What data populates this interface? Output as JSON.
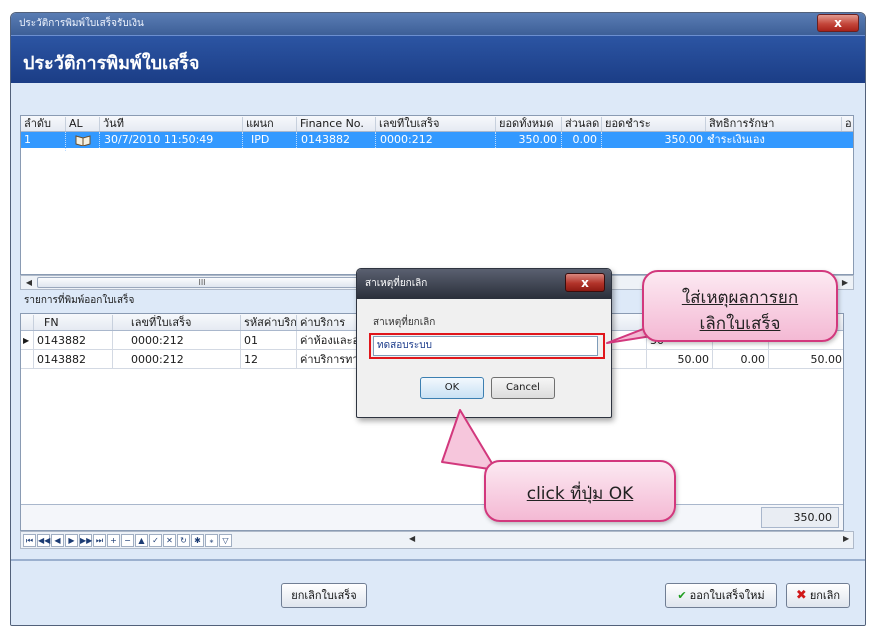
{
  "window": {
    "title": "ประวัติการพิมพ์ใบเสร็จรับเงิน",
    "close_glyph": "x"
  },
  "header": {
    "title": "ประวัติการพิมพ์ใบเสร็จ"
  },
  "receipts_grid": {
    "columns": [
      "ลำดับ",
      "AL",
      "วันที่",
      "แผนก",
      "Finance No.",
      "เลขที่ใบเสร็จ",
      "ยอดทั้งหมด",
      "ส่วนลด",
      "ยอดชำระ",
      "สิทธิการรักษา",
      "อ"
    ],
    "rows": [
      {
        "seq": "1",
        "al_icon": "book-icon",
        "date": "30/7/2010 11:50:49",
        "dept": "IPD",
        "finance_no": "0143882",
        "receipt_no": "0000:212",
        "total": "350.00",
        "discount": "0.00",
        "paid": "350.00",
        "right": "ชำระเงินเอง"
      }
    ],
    "scroll_glyph": "III"
  },
  "items_section": {
    "label": "รายการที่พิมพ์ออกใบเสร็จ"
  },
  "items_grid": {
    "columns": [
      "FN",
      "เลขที่ใบเสร็จ",
      "รหัสค่าบริก",
      "ค่าบริการ"
    ],
    "rows": [
      {
        "fn": "0143882",
        "receipt_no": "0000:212",
        "code": "01",
        "service": "ค่าห้องและอ",
        "amount": "30",
        "discount": "",
        "net": ""
      },
      {
        "fn": "0143882",
        "receipt_no": "0000:212",
        "code": "12",
        "service": "ค่าบริการทา",
        "amount": "50.00",
        "discount": "0.00",
        "net": "50.00"
      }
    ],
    "total": "350.00"
  },
  "bottom_bar": {
    "cancel_receipt": "ยกเลิกใบเสร็จ",
    "new_receipt": "ออกใบเสร็จใหม่",
    "cancel": "ยกเลิก"
  },
  "dialog": {
    "title": "สาเหตุที่ยกเลิก",
    "close_glyph": "x",
    "label": "สาเหตุที่ยกเลิก",
    "reason_value": "ทดสอบระบบ",
    "ok": "OK",
    "cancel": "Cancel"
  },
  "annotations": {
    "reason_line1": "ใส่เหตุผลการยก",
    "reason_line2": "เลิกใบเสร็จ",
    "click_ok": "click ที่ปุ่ม OK"
  },
  "colors": {
    "selection": "#3399ff",
    "header_blue": "#1b3d86",
    "callout_pink": "#f4b9d4",
    "highlight_red": "#e0161b"
  }
}
